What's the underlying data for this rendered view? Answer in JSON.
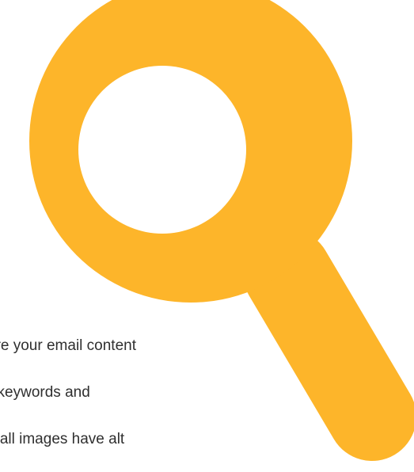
{
  "text_lines": [
    "ure your email content",
    "t keywords and",
    "e all images have alt"
  ],
  "icon": {
    "name": "magnifying-glass-icon",
    "color": "#FDB52A"
  }
}
